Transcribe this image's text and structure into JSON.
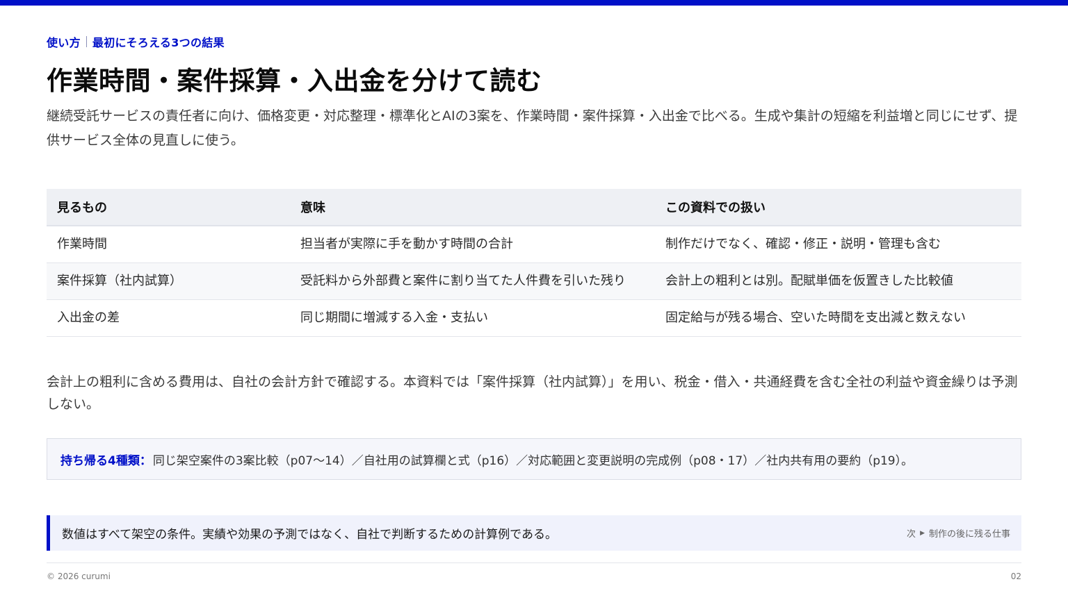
{
  "header": {
    "eyebrow_section": "使い方",
    "eyebrow_topic": "最初にそろえる3つの結果",
    "title": "作業時間・案件採算・入出金を分けて読む",
    "lead": "継続受託サービスの責任者に向け、価格変更・対応整理・標準化とAIの3案を、作業時間・案件採算・入出金で比べる。生成や集計の短縮を利益増と同じにせず、提供サービス全体の見直しに使う。"
  },
  "table": {
    "headers": [
      "見るもの",
      "意味",
      "この資料での扱い"
    ],
    "rows": [
      [
        "作業時間",
        "担当者が実際に手を動かす時間の合計",
        "制作だけでなく、確認・修正・説明・管理も含む"
      ],
      [
        "案件採算（社内試算）",
        "受託料から外部費と案件に割り当てた人件費を引いた残り",
        "会計上の粗利とは別。配賦単価を仮置きした比較値"
      ],
      [
        "入出金の差",
        "同じ期間に増減する入金・支払い",
        "固定給与が残る場合、空いた時間を支出減と数えない"
      ]
    ]
  },
  "note": "会計上の粗利に含める費用は、自社の会計方針で確認する。本資料では「案件採算（社内試算）」を用い、税金・借入・共通経費を含む全社の利益や資金繰りは予測しない。",
  "takeaway": {
    "label": "持ち帰る4種類：",
    "text": "同じ架空案件の3案比較（p07〜14）／自社用の試算欄と式（p16）／対応範囲と変更説明の完成例（p08・17）／社内共有用の要約（p19）。"
  },
  "disclaimer": {
    "text": "数値はすべて架空の条件。実績や効果の予測ではなく、自社で判断するための計算例である。",
    "next_prefix": "次",
    "next_title": "制作の後に残る仕事"
  },
  "footer": {
    "copyright": "© 2026 curumi",
    "page": "02"
  },
  "colors": {
    "accent": "#0010c8",
    "header_bg": "#eef0f4",
    "callout_bg": "#f0f2fc"
  }
}
